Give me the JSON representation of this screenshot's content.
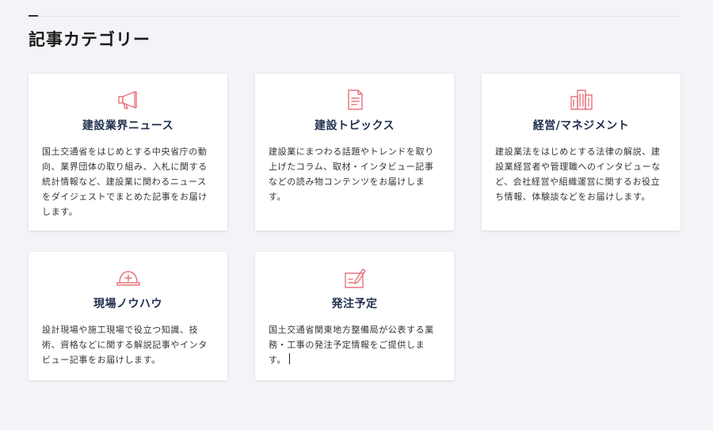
{
  "section": {
    "title": "記事カテゴリー"
  },
  "accent_color": "#e8737e",
  "title_color": "#22304f",
  "cards": [
    {
      "icon": "megaphone-icon",
      "title": "建設業界ニュース",
      "description": "国土交通省をはじめとする中央省庁の動向、業界団体の取り組み、入札に関する統計情報など、建設業に関わるニュースをダイジェストでまとめた記事をお届けします。"
    },
    {
      "icon": "document-icon",
      "title": "建設トピックス",
      "description": "建設業にまつわる話題やトレンドを取り上げたコラム、取材・インタビュー記事などの読み物コンテンツをお届けします。"
    },
    {
      "icon": "building-icon",
      "title": "経営/マネジメント",
      "description": "建設業法をはじめとする法律の解説、建設業経営者や管理職へのインタビューなど、会社経営や組織運営に関するお役立ち情報、体験談などをお届けします。"
    },
    {
      "icon": "hard-hat-icon",
      "title": "現場ノウハウ",
      "description": "設計現場や施工現場で役立つ知識、技術、資格などに関する解説記事やインタビュー記事をお届けします。"
    },
    {
      "icon": "order-form-icon",
      "title": "発注予定",
      "description": "国土交通省関東地方整備局が公表する業務・工事の発注予定情報をご提供します。"
    }
  ]
}
